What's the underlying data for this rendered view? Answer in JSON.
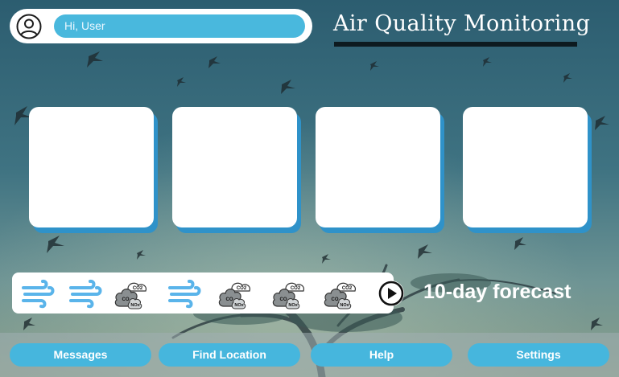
{
  "header": {
    "greeting": "Hi, User",
    "title": "Air Quality Monitoring",
    "avatar_icon": "user-circle-icon"
  },
  "cards": [
    {
      "content": ""
    },
    {
      "content": ""
    },
    {
      "content": ""
    },
    {
      "content": ""
    }
  ],
  "forecast": {
    "label": "10-day forecast",
    "play_icon": "play-circle-icon",
    "icons": [
      {
        "icon": "wind-icon"
      },
      {
        "icon": "wind-icon"
      },
      {
        "icon": "pollution-cloud-icon",
        "labels": [
          "CO2",
          "CO",
          "NOx"
        ]
      },
      {
        "icon": "wind-icon"
      },
      {
        "icon": "pollution-cloud-icon",
        "labels": [
          "CO2",
          "CO",
          "NOx"
        ]
      },
      {
        "icon": "pollution-cloud-icon",
        "labels": [
          "CO2",
          "CO",
          "NOx"
        ]
      },
      {
        "icon": "pollution-cloud-icon",
        "labels": [
          "CO2",
          "CO",
          "NOx"
        ]
      }
    ]
  },
  "nav": {
    "messages": "Messages",
    "find_location": "Find Location",
    "help": "Help",
    "settings": "Settings"
  },
  "colors": {
    "accent": "#46b6dd",
    "card_shadow": "#2f92c9",
    "wind_icon": "#5ab4ea"
  }
}
